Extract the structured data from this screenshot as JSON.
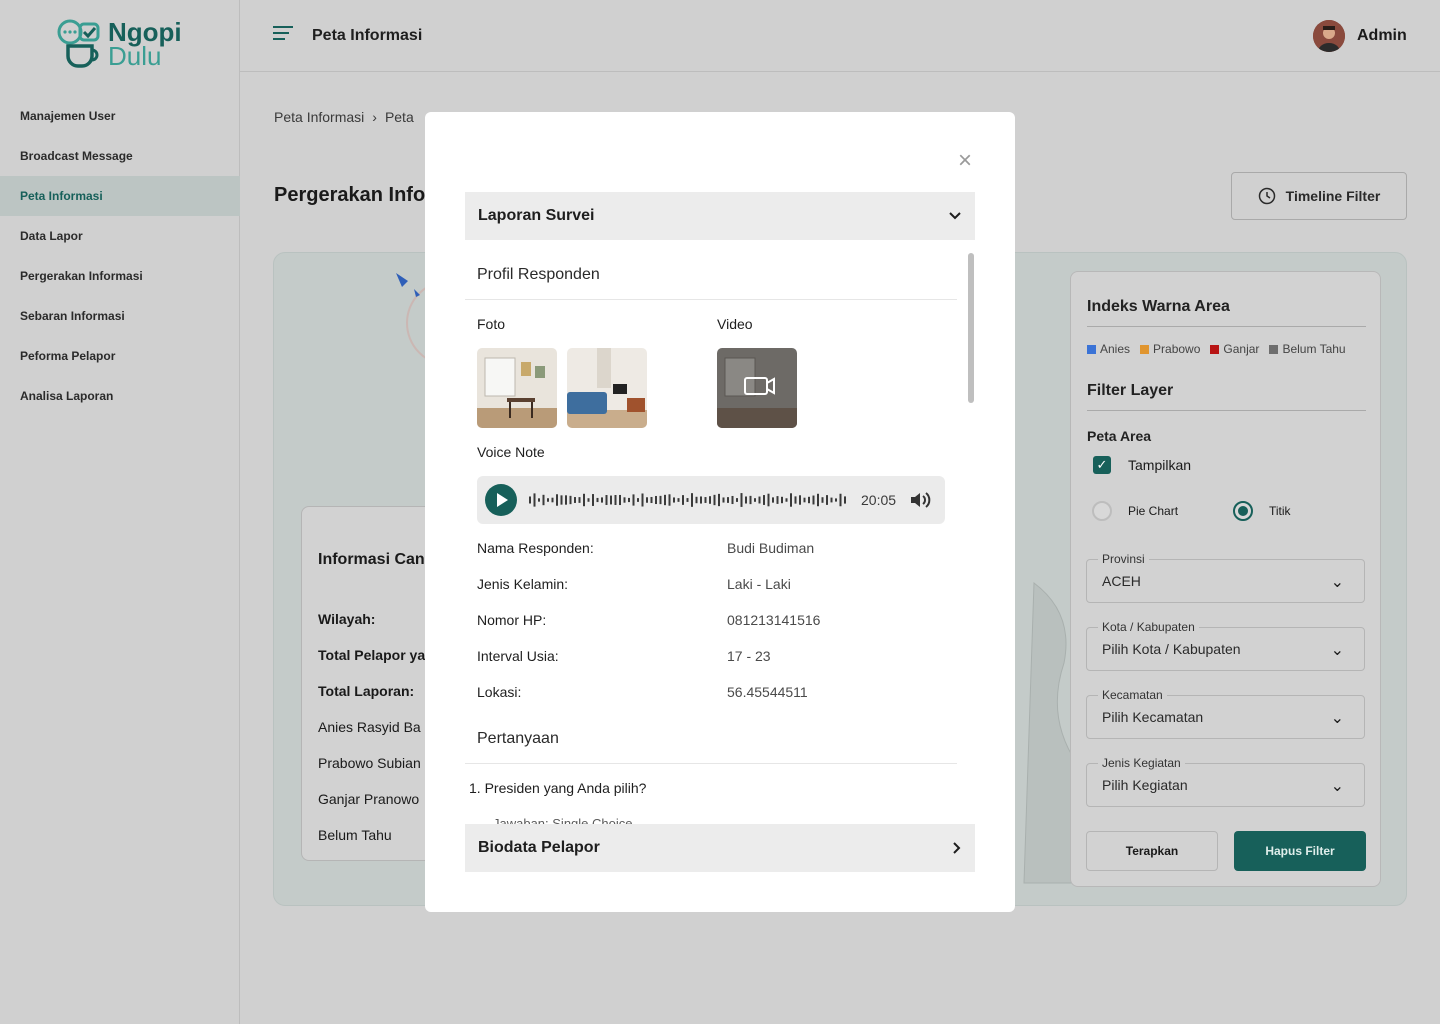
{
  "app": {
    "logo_line1": "Ngopi",
    "logo_line2": "Dulu"
  },
  "sidebar": {
    "items": [
      {
        "label": "Manajemen User"
      },
      {
        "label": "Broadcast Message"
      },
      {
        "label": "Peta Informasi",
        "active": true
      },
      {
        "label": "Data Lapor"
      },
      {
        "label": "Pergerakan Informasi"
      },
      {
        "label": "Sebaran Informasi"
      },
      {
        "label": "Peforma Pelapor"
      },
      {
        "label": "Analisa Laporan"
      }
    ]
  },
  "header": {
    "title": "Peta Informasi",
    "user": "Admin"
  },
  "breadcrumb": {
    "first": "Peta Informasi",
    "second": "Peta"
  },
  "page": {
    "title": "Pergerakan Info",
    "timeline_filter": "Timeline Filter"
  },
  "info_card": {
    "title": "Informasi Can",
    "rows": [
      "Wilayah:",
      "Total Pelapor ya",
      "Total Laporan:",
      "Anies Rasyid Ba",
      "Prabowo Subian",
      "Ganjar Pranowo",
      "Belum Tahu"
    ]
  },
  "filter_panel": {
    "index_title": "Indeks Warna Area",
    "legend": [
      {
        "label": "Anies",
        "color": "#3b73d6"
      },
      {
        "label": "Prabowo",
        "color": "#e0952f"
      },
      {
        "label": "Ganjar",
        "color": "#b81414"
      },
      {
        "label": "Belum Tahu",
        "color": "#6e6e6e"
      }
    ],
    "layer_title": "Filter Layer",
    "peta_area": "Peta Area",
    "tampilkan": "Tampilkan",
    "radio_pie": "Pie Chart",
    "radio_titik": "Titik",
    "provinsi_label": "Provinsi",
    "provinsi_value": "ACEH",
    "kota_label": "Kota / Kabupaten",
    "kota_value": "Pilih Kota / Kabupaten",
    "kecamatan_label": "Kecamatan",
    "kecamatan_value": "Pilih Kecamatan",
    "kegiatan_label": "Jenis Kegiatan",
    "kegiatan_value": "Pilih Kegiatan",
    "btn_terapkan": "Terapkan",
    "btn_hapus": "Hapus Filter"
  },
  "modal": {
    "accordion1": "Laporan Survei",
    "accordion2": "Biodata Pelapor",
    "profil_title": "Profil Responden",
    "foto_label": "Foto",
    "video_label": "Video",
    "voice_label": "Voice Note",
    "voice_duration": "20:05",
    "fields": [
      {
        "key": "Nama Responden:",
        "value": "Budi Budiman"
      },
      {
        "key": "Jenis Kelamin:",
        "value": "Laki - Laki"
      },
      {
        "key": "Nomor HP:",
        "value": "081213141516"
      },
      {
        "key": "Interval Usia:",
        "value": "17 - 23"
      },
      {
        "key": "Lokasi:",
        "value": "56.45544511"
      }
    ],
    "pertanyaan_title": "Pertanyaan",
    "question1": "1. Presiden yang Anda pilih?",
    "question1_sub": "Jawaban: Single Choice"
  },
  "colors": {
    "brand": "#17605a",
    "overlay": "#d0d0d0"
  }
}
